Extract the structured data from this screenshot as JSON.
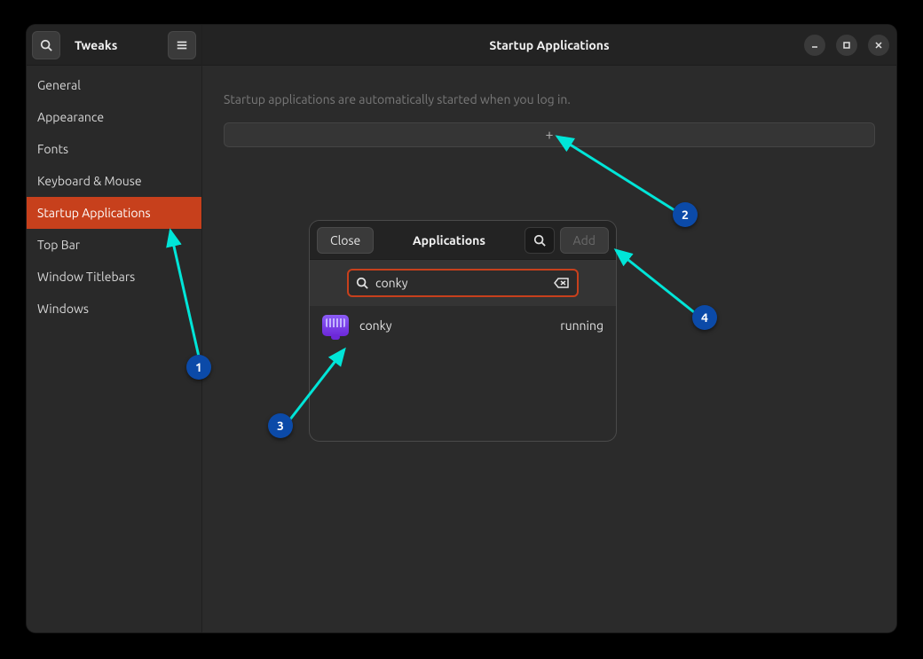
{
  "sidebar": {
    "title": "Tweaks",
    "items": [
      {
        "label": "General"
      },
      {
        "label": "Appearance"
      },
      {
        "label": "Fonts"
      },
      {
        "label": "Keyboard & Mouse"
      },
      {
        "label": "Startup Applications"
      },
      {
        "label": "Top Bar"
      },
      {
        "label": "Window Titlebars"
      },
      {
        "label": "Windows"
      }
    ],
    "active_index": 4
  },
  "main": {
    "title": "Startup Applications",
    "description": "Startup applications are automatically started when you log in.",
    "add_symbol": "+"
  },
  "dialog": {
    "close_label": "Close",
    "title": "Applications",
    "add_label": "Add",
    "search": {
      "value": "conky"
    },
    "results": [
      {
        "name": "conky",
        "status": "running"
      }
    ]
  },
  "annotations": {
    "markers": [
      "1",
      "2",
      "3",
      "4"
    ]
  }
}
